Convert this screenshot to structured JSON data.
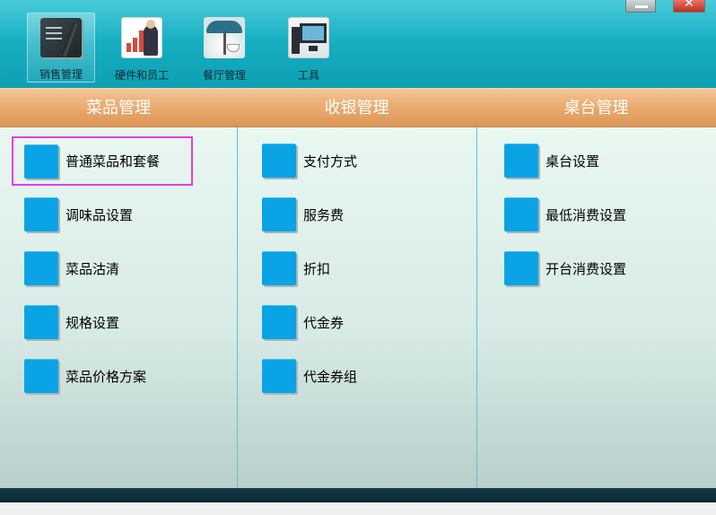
{
  "toolbar": {
    "buttons": [
      {
        "label": "销售管理",
        "icon": "ledger-pen-icon"
      },
      {
        "label": "硬件和员工",
        "icon": "chart-person-icon"
      },
      {
        "label": "餐厅管理",
        "icon": "cafe-umbrella-icon"
      },
      {
        "label": "工具",
        "icon": "computer-icon"
      }
    ],
    "active_index": 0
  },
  "window": {
    "minimize_glyph": "",
    "close_glyph": "✕"
  },
  "sections": [
    {
      "title": "菜品管理",
      "items": [
        "普通菜品和套餐",
        "调味品设置",
        "菜品沽清",
        "规格设置",
        "菜品价格方案"
      ]
    },
    {
      "title": "收银管理",
      "items": [
        "支付方式",
        "服务费",
        "折扣",
        "代金券",
        "代金券组"
      ]
    },
    {
      "title": "桌台管理",
      "items": [
        "桌台设置",
        "最低消费设置",
        "开台消费设置"
      ]
    }
  ],
  "selected_item": "普通菜品和套餐",
  "colors": {
    "toolbar": "#15afc2",
    "header": "#e8a86b",
    "tile": "#0aa3e6",
    "selection": "#e040e0",
    "footer": "#133a47"
  }
}
